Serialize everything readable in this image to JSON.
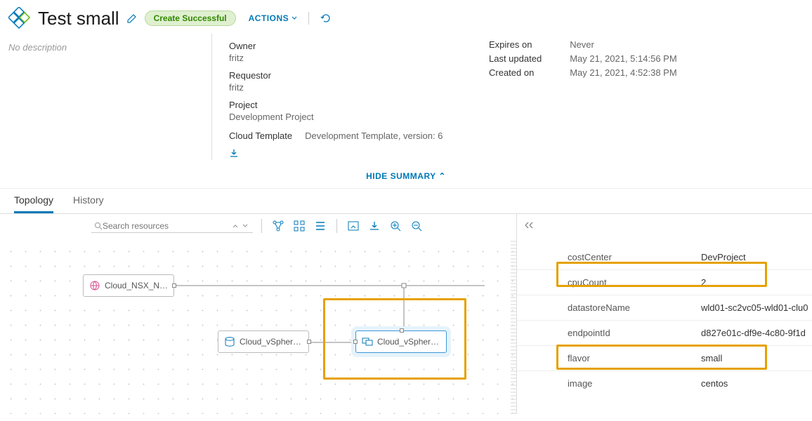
{
  "header": {
    "title": "Test small",
    "status": "Create Successful",
    "actions_label": "ACTIONS",
    "description": "No description"
  },
  "summary": {
    "owner_label": "Owner",
    "owner": "fritz",
    "requestor_label": "Requestor",
    "requestor": "fritz",
    "project_label": "Project",
    "project": "Development Project",
    "template_label": "Cloud Template",
    "template": "Development Template, version: 6",
    "expires_label": "Expires on",
    "expires": "Never",
    "updated_label": "Last updated",
    "updated": "May 21, 2021, 5:14:56 PM",
    "created_label": "Created on",
    "created": "May 21, 2021, 4:52:38 PM",
    "hide_label": "HIDE SUMMARY"
  },
  "tabs": {
    "topology": "Topology",
    "history": "History"
  },
  "toolbar": {
    "search_placeholder": "Search resources"
  },
  "nodes": {
    "nsx": "Cloud_NSX_N…",
    "disk": "Cloud_vSpher…",
    "vm": "Cloud_vSpher…"
  },
  "props": [
    {
      "key": "costCenter",
      "val": "DevProject"
    },
    {
      "key": "cpuCount",
      "val": "2"
    },
    {
      "key": "datastoreName",
      "val": "wld01-sc2vc05-wld01-clu0"
    },
    {
      "key": "endpointId",
      "val": "d827e01c-df9e-4c80-9f1d"
    },
    {
      "key": "flavor",
      "val": "small"
    },
    {
      "key": "image",
      "val": "centos"
    }
  ]
}
